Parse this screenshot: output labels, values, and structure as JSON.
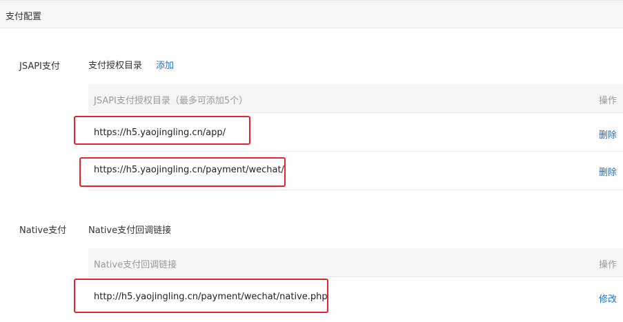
{
  "header": {
    "title": "支付配置"
  },
  "jsapi": {
    "label": "JSAPI支付",
    "subtitle": "支付授权目录",
    "add_link": "添加",
    "table": {
      "col_dir": "JSAPI支付授权目录（最多可添加5个）",
      "col_action": "操作",
      "rows": [
        {
          "url": "https://h5.yaojingling.cn/app/",
          "action": "删除"
        },
        {
          "url": "https://h5.yaojingling.cn/payment/wechat/",
          "action": "删除"
        }
      ]
    }
  },
  "native": {
    "label": "Native支付",
    "subtitle": "Native支付回调链接",
    "table": {
      "col_link": "Native支付回调链接",
      "col_action": "操作",
      "rows": [
        {
          "url": "http://h5.yaojingling.cn/payment/wechat/native.php",
          "action": "修改"
        }
      ]
    }
  },
  "colors": {
    "link": "#1f6fc5",
    "highlight": "#e8222a",
    "header_bg": "#f7f7f7"
  }
}
